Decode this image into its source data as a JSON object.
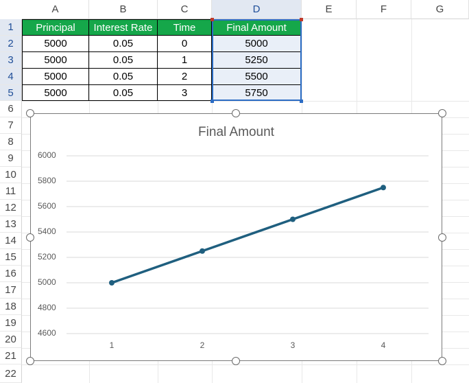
{
  "sheet": {
    "columns": [
      "A",
      "B",
      "C",
      "D",
      "E",
      "F",
      "G"
    ],
    "rows": [
      "1",
      "2",
      "3",
      "4",
      "5",
      "6",
      "7",
      "8",
      "9",
      "10",
      "11",
      "12",
      "13",
      "14",
      "15",
      "16",
      "17",
      "18",
      "19",
      "20",
      "21",
      "22"
    ],
    "table": {
      "headers": [
        "Principal",
        "Interest Rate",
        "Time",
        "Final Amount"
      ],
      "rows": [
        [
          "5000",
          "0.05",
          "0",
          "5000"
        ],
        [
          "5000",
          "0.05",
          "1",
          "5250"
        ],
        [
          "5000",
          "0.05",
          "2",
          "5500"
        ],
        [
          "5000",
          "0.05",
          "3",
          "5750"
        ]
      ]
    },
    "selected_range": "D1:D5",
    "colors": {
      "header_fill": "#15a74a",
      "header_text": "#ffffff",
      "selection": "#2b6cc4",
      "selected_fill": "#e9eff8"
    }
  },
  "chart_data": {
    "type": "line",
    "title": "Final Amount",
    "categories": [
      "1",
      "2",
      "3",
      "4"
    ],
    "series": [
      {
        "values": [
          5000,
          5250,
          5500,
          5750
        ],
        "color": "#1f5f7f"
      }
    ],
    "yticks": [
      "4600",
      "4800",
      "5000",
      "5200",
      "5400",
      "5600",
      "5800",
      "6000"
    ],
    "ylim": [
      4600,
      6000
    ],
    "grid": true,
    "legend": "none"
  }
}
